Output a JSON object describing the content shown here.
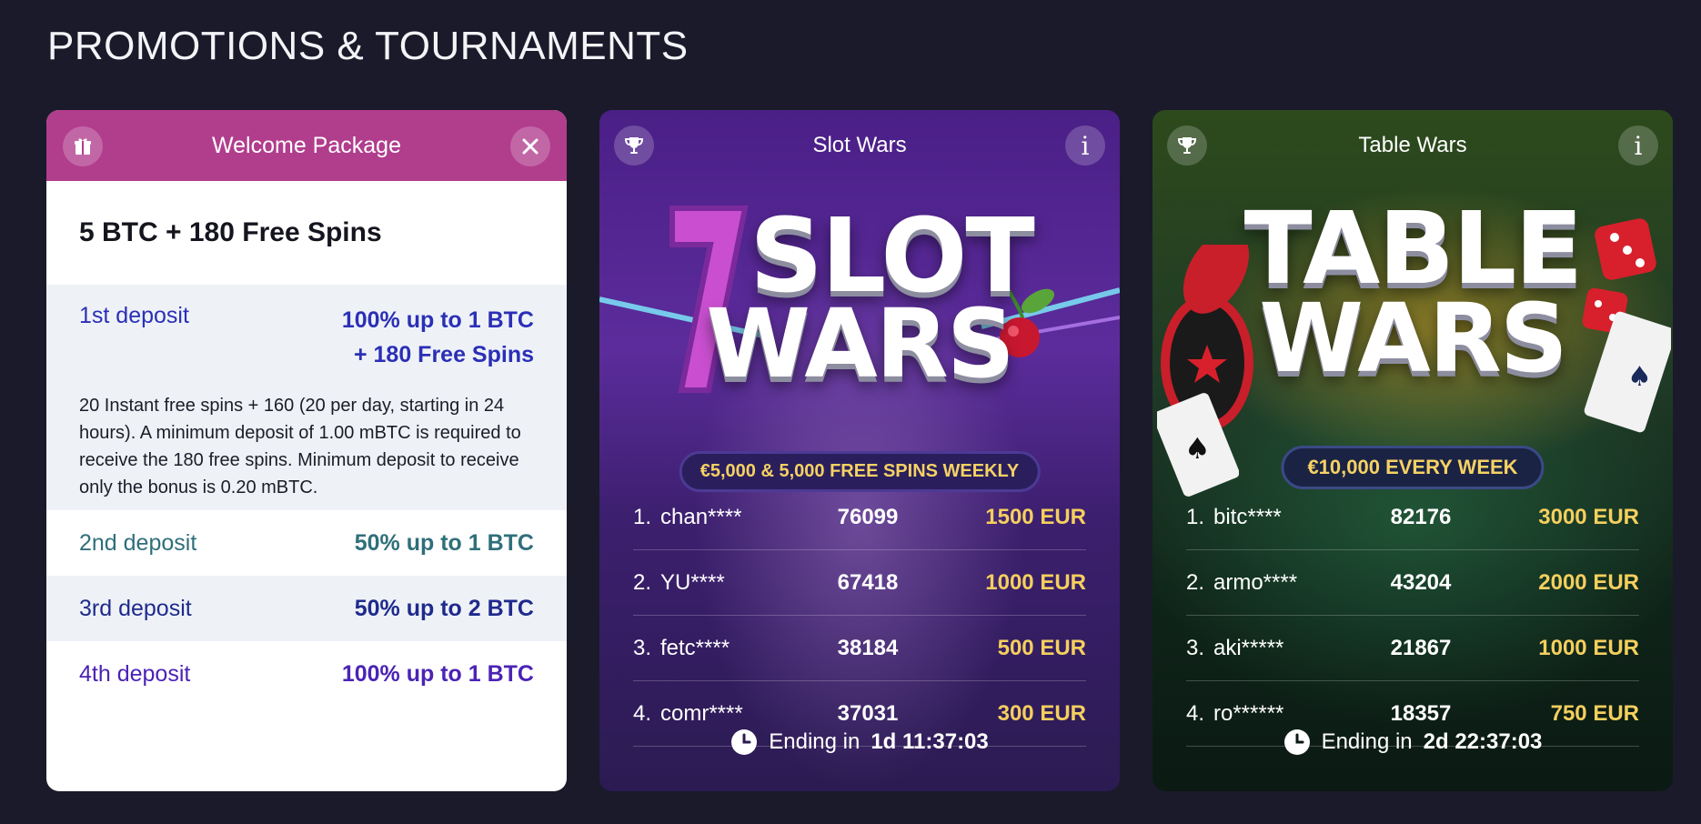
{
  "page_title": "PROMOTIONS & TOURNAMENTS",
  "welcome": {
    "title": "Welcome Package",
    "subtitle": "5 BTC + 180 Free Spins",
    "deposits": [
      {
        "label": "1st deposit",
        "value_line1": "100% up to 1 BTC",
        "value_line2": "+ 180 Free Spins",
        "description": "20 Instant free spins + 160 (20 per day, starting in 24 hours). A minimum deposit of 1.00 mBTC is required to receive the 180 free spins. Minimum deposit to receive only the bonus is 0.20 mBTC."
      },
      {
        "label": "2nd deposit",
        "value": "50% up to 1 BTC"
      },
      {
        "label": "3rd deposit",
        "value": "50% up to 2 BTC"
      },
      {
        "label": "4th deposit",
        "value": "100% up to 1 BTC"
      }
    ]
  },
  "slot_wars": {
    "title": "Slot Wars",
    "banner_line1": "SLOT",
    "banner_line2": "WARS",
    "banner_pill": "€5,000 & 5,000 FREE SPINS WEEKLY",
    "leaderboard": [
      {
        "rank": "1.",
        "name": "chan****",
        "score": "76099",
        "prize": "1500 EUR"
      },
      {
        "rank": "2.",
        "name": "YU****",
        "score": "67418",
        "prize": "1000 EUR"
      },
      {
        "rank": "3.",
        "name": "fetc****",
        "score": "38184",
        "prize": "500 EUR"
      },
      {
        "rank": "4.",
        "name": "comr****",
        "score": "37031",
        "prize": "300 EUR"
      }
    ],
    "ending_label": "Ending in",
    "ending_time": "1d 11:37:03"
  },
  "table_wars": {
    "title": "Table Wars",
    "banner_line1": "TABLE",
    "banner_line2": "WARS",
    "banner_pill": "€10,000 EVERY WEEK",
    "leaderboard": [
      {
        "rank": "1.",
        "name": "bitc****",
        "score": "82176",
        "prize": "3000 EUR"
      },
      {
        "rank": "2.",
        "name": "armo****",
        "score": "43204",
        "prize": "2000 EUR"
      },
      {
        "rank": "3.",
        "name": "aki*****",
        "score": "21867",
        "prize": "1000 EUR"
      },
      {
        "rank": "4.",
        "name": "ro******",
        "score": "18357",
        "prize": "750 EUR"
      }
    ],
    "ending_label": "Ending in",
    "ending_time": "2d 22:37:03"
  },
  "icons": {
    "gift": "gift-icon",
    "close": "close-icon",
    "trophy": "trophy-icon",
    "info": "info-icon",
    "clock": "clock-icon"
  },
  "colors": {
    "background": "#1b1a2a",
    "welcome_header": "#b13d8d",
    "prize_gold": "#f4cf5e"
  }
}
